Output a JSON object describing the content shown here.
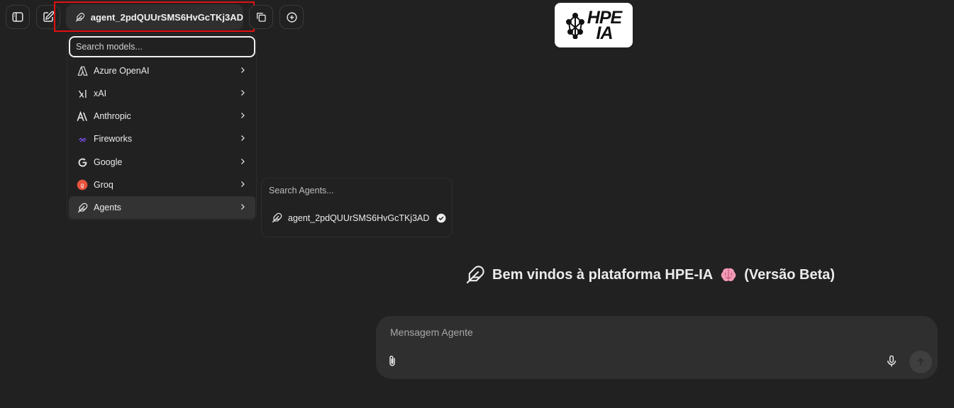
{
  "header": {
    "model_label": "agent_2pdQUUrSMS6HvGcTKj3AD",
    "icons": [
      "sidebar-toggle-icon",
      "new-chat-icon",
      "feather-icon",
      "copy-icon",
      "plus-circle-icon"
    ]
  },
  "logo": {
    "line1": "HPE",
    "line2": "IA"
  },
  "model_menu": {
    "search_placeholder": "Search models...",
    "items": [
      {
        "label": "Azure OpenAI",
        "icon": "azure-icon"
      },
      {
        "label": "xAI",
        "icon": "xai-icon"
      },
      {
        "label": "Anthropic",
        "icon": "anthropic-icon"
      },
      {
        "label": "Fireworks",
        "icon": "fireworks-icon"
      },
      {
        "label": "Google",
        "icon": "google-icon"
      },
      {
        "label": "Groq",
        "icon": "groq-icon"
      },
      {
        "label": "Agents",
        "icon": "feather-icon"
      }
    ]
  },
  "agents_submenu": {
    "search_placeholder": "Search Agents...",
    "items": [
      {
        "label": "agent_2pdQUUrSMS6HvGcTKj3AD",
        "selected": true
      }
    ]
  },
  "welcome": {
    "text": "Bem vindos à plataforma HPE-IA",
    "suffix": "(Versão Beta)",
    "emoji": "🧠"
  },
  "composer": {
    "placeholder": "Mensagem Agente"
  },
  "colors": {
    "background": "#212121",
    "panel": "#2f2f2f",
    "highlight": "#e01010"
  }
}
